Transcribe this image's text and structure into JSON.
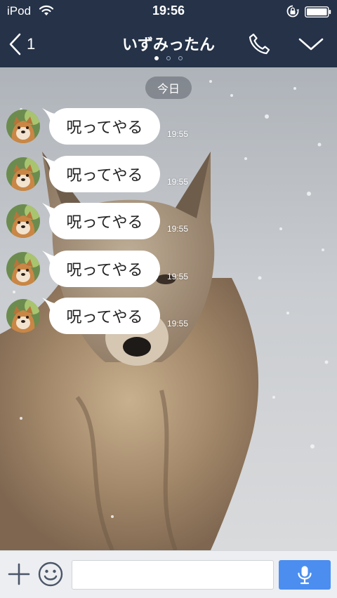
{
  "status_bar": {
    "carrier": "iPod",
    "time": "19:56"
  },
  "nav": {
    "back_count": "1",
    "title": "いずみったん",
    "page_dots": 3,
    "active_dot": 0
  },
  "chat": {
    "date_label": "今日",
    "messages": [
      {
        "text": "呪ってやる",
        "time": "19:55"
      },
      {
        "text": "呪ってやる",
        "time": "19:55"
      },
      {
        "text": "呪ってやる",
        "time": "19:55"
      },
      {
        "text": "呪ってやる",
        "time": "19:55"
      },
      {
        "text": "呪ってやる",
        "time": "19:55"
      }
    ]
  },
  "input_bar": {
    "message_value": "",
    "message_placeholder": ""
  },
  "colors": {
    "header_bg": "#253248",
    "mic_button": "#4b8ef0",
    "bubble": "#ffffff"
  },
  "icons": [
    "wifi-icon",
    "rotation-lock-icon",
    "battery-icon",
    "back-chevron-icon",
    "phone-icon",
    "chevron-down-icon",
    "plus-icon",
    "smiley-icon",
    "microphone-icon"
  ]
}
